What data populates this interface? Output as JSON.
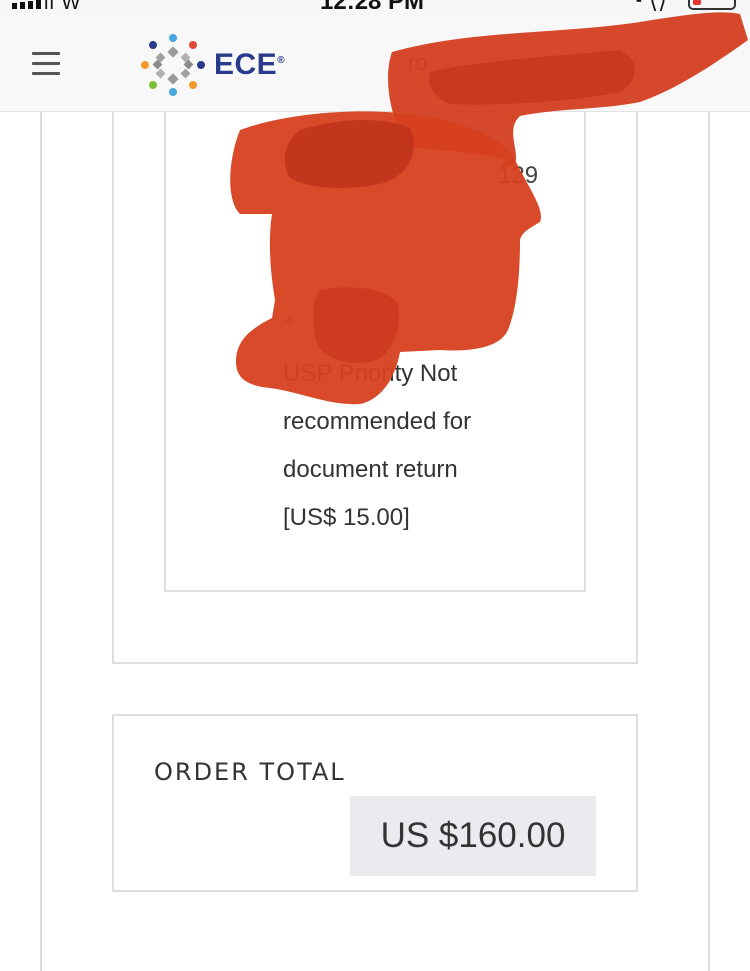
{
  "status_bar": {
    "carrier": "ll W",
    "time": "12:28 PM"
  },
  "header": {
    "brand": "ECE",
    "brand_mark": "®",
    "partial_text": "ro",
    "menu_icon": "hamburger-icon"
  },
  "shipping_option": {
    "partial_number": "129",
    "partial_symbol": "+",
    "description_lines": [
      "USP  Priority Not",
      "recommended for",
      "document return",
      "[US$ 15.00]"
    ]
  },
  "order_total": {
    "label": "ORDER TOTAL",
    "amount": "US $160.00"
  },
  "colors": {
    "brand_blue": "#2a3a8c",
    "redaction_red": "#d33a1c",
    "total_bg": "#e9ebee",
    "border": "#dedede"
  }
}
